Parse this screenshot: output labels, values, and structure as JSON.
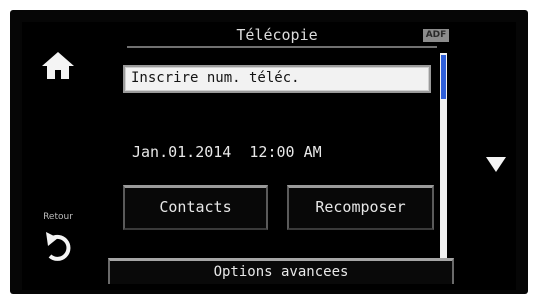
{
  "header": {
    "title": "Télécopie",
    "adf_badge": "ADF"
  },
  "nav": {
    "home_icon": "home-icon",
    "back_label": "Retour",
    "back_icon": "back-arrow-icon"
  },
  "fax_input": {
    "placeholder": "Inscrire num. téléc."
  },
  "status": {
    "datetime": "Jan.01.2014  12:00 AM"
  },
  "buttons": {
    "contacts": "Contacts",
    "redial": "Recomposer",
    "options": "Options avancees"
  },
  "scroll": {
    "down_icon": "scroll-down-icon"
  },
  "colors": {
    "screen_bg": "#000000",
    "scroll_thumb": "#2f5fd8",
    "input_bg": "#f2f2f2"
  }
}
